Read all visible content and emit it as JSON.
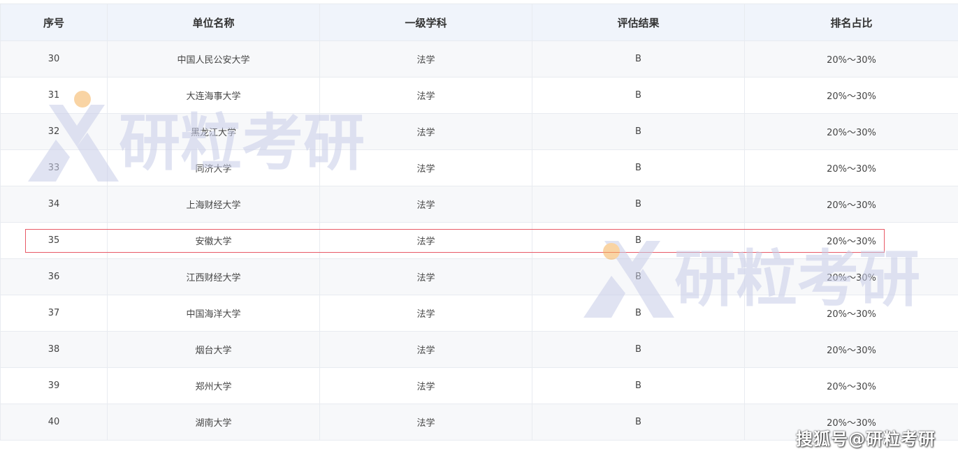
{
  "table": {
    "headers": [
      "序号",
      "单位名称",
      "一级学科",
      "评估结果",
      "排名占比"
    ],
    "rows": [
      {
        "idx": "30",
        "name": "中国人民公安大学",
        "subject": "法学",
        "result": "B",
        "rank": "20%～30%"
      },
      {
        "idx": "31",
        "name": "大连海事大学",
        "subject": "法学",
        "result": "B",
        "rank": "20%～30%"
      },
      {
        "idx": "32",
        "name": "黑龙江大学",
        "subject": "法学",
        "result": "B",
        "rank": "20%～30%"
      },
      {
        "idx": "33",
        "name": "同济大学",
        "subject": "法学",
        "result": "B",
        "rank": "20%～30%"
      },
      {
        "idx": "34",
        "name": "上海财经大学",
        "subject": "法学",
        "result": "B",
        "rank": "20%～30%"
      },
      {
        "idx": "35",
        "name": "安徽大学",
        "subject": "法学",
        "result": "B",
        "rank": "20%～30%"
      },
      {
        "idx": "36",
        "name": "江西财经大学",
        "subject": "法学",
        "result": "B",
        "rank": "20%～30%"
      },
      {
        "idx": "37",
        "name": "中国海洋大学",
        "subject": "法学",
        "result": "B",
        "rank": "20%～30%"
      },
      {
        "idx": "38",
        "name": "烟台大学",
        "subject": "法学",
        "result": "B",
        "rank": "20%～30%"
      },
      {
        "idx": "39",
        "name": "郑州大学",
        "subject": "法学",
        "result": "B",
        "rank": "20%～30%"
      },
      {
        "idx": "40",
        "name": "湖南大学",
        "subject": "法学",
        "result": "B",
        "rank": "20%～30%"
      }
    ]
  },
  "highlight_row_index": 5,
  "watermark": {
    "text": "研粒考研",
    "accent_color": "#f5b25a",
    "mark_color": "#c8cde8"
  },
  "footer": {
    "credit": "搜狐号@研粒考研"
  },
  "colors": {
    "header_bg": "#f0f4fb",
    "row_alt_bg": "#f7f8fa",
    "highlight_border": "#e85a66"
  }
}
